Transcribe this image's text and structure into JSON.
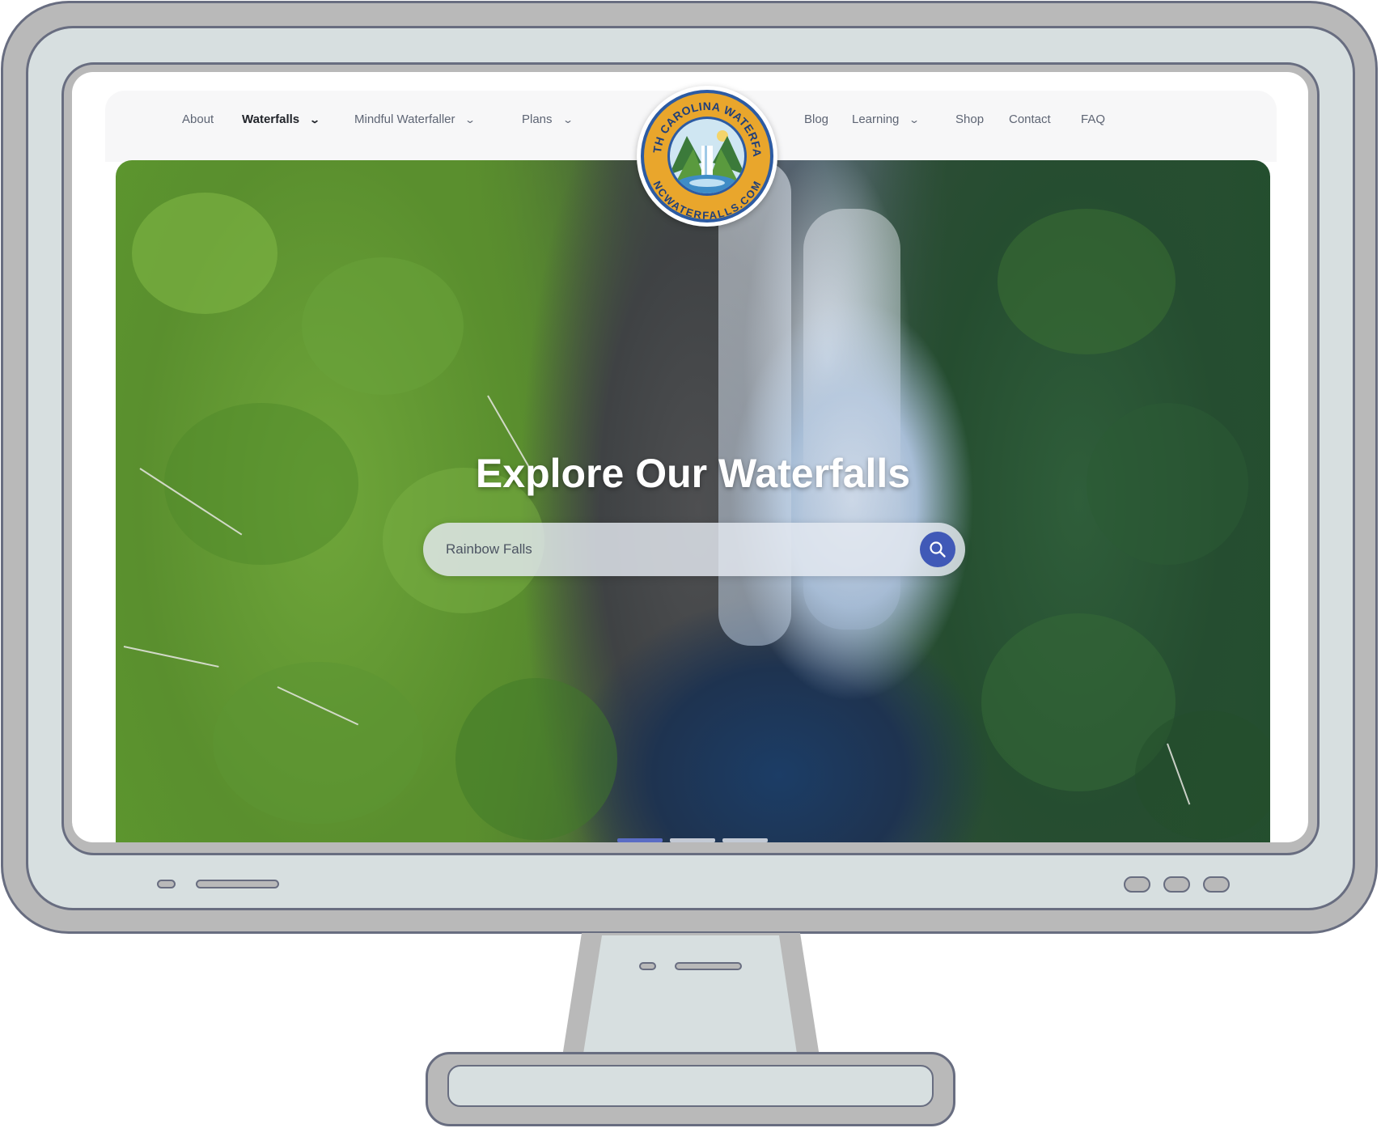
{
  "nav": {
    "left": [
      {
        "label": "About"
      },
      {
        "label": "Waterfalls"
      },
      {
        "label": "Mindful Waterfaller"
      },
      {
        "label": "Plans"
      }
    ],
    "right": [
      {
        "label": "Blog"
      },
      {
        "label": "Learning"
      },
      {
        "label": "Shop"
      },
      {
        "label": "Contact"
      },
      {
        "label": "FAQ"
      }
    ],
    "active": "Waterfalls"
  },
  "logo": {
    "top_text": "NORTH CAROLINA WATERFALLS",
    "bottom_text": "NCWATERFALLS.COM"
  },
  "hero": {
    "title": "Explore Our Waterfalls",
    "search_value": "Rainbow Falls",
    "slides_total": 3,
    "active_slide": 1
  },
  "icons": {
    "search": "search-icon",
    "dropdown": "chevron-down-icon"
  },
  "colors": {
    "accent": "#4059b7",
    "logo_ring": "#e9a62c",
    "logo_blue": "#2c5ba3",
    "nav_text": "#5e6574",
    "nav_active": "#22252b"
  }
}
